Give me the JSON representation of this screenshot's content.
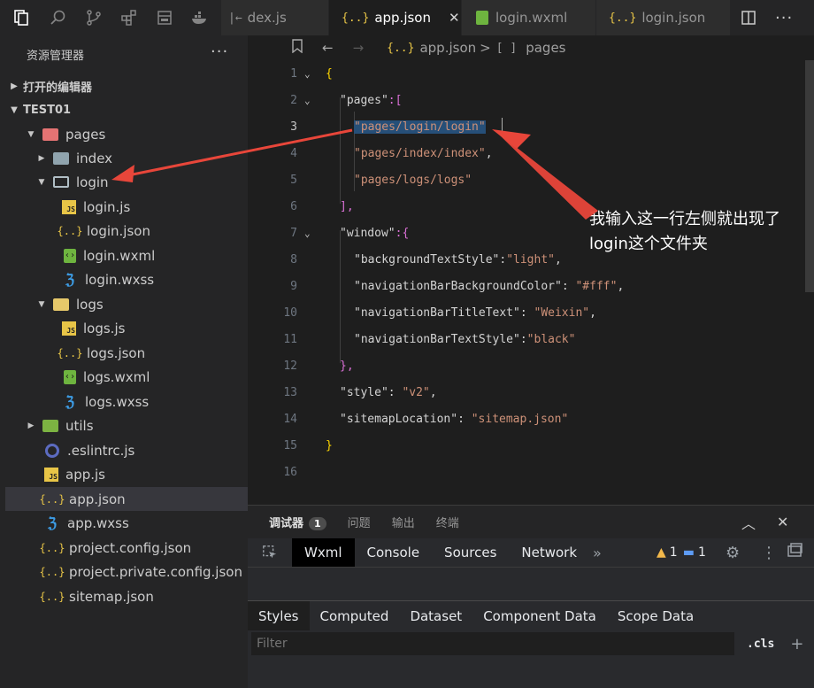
{
  "tabs": [
    {
      "label": "dex.js",
      "icon": "split-icon",
      "active": false
    },
    {
      "label": "app.json",
      "icon": "json-icon",
      "active": true
    },
    {
      "label": "login.wxml",
      "icon": "wxml-icon",
      "active": false
    },
    {
      "label": "login.json",
      "icon": "json-icon",
      "active": false
    }
  ],
  "tab_close": "✕",
  "json_icon_glyph": "{..}",
  "sidebar": {
    "title": "资源管理器",
    "more": "···",
    "open_editors": "打开的编辑器",
    "project": "TEST01",
    "items": [
      {
        "label": "pages",
        "icon": "folder-red"
      },
      {
        "label": "index",
        "icon": "folder"
      },
      {
        "label": "login",
        "icon": "folder-open"
      },
      {
        "label": "login.js",
        "icon": "js"
      },
      {
        "label": "login.json",
        "icon": "json"
      },
      {
        "label": "login.wxml",
        "icon": "wxml"
      },
      {
        "label": "login.wxss",
        "icon": "wxss"
      },
      {
        "label": "logs",
        "icon": "folder-yellow"
      },
      {
        "label": "logs.js",
        "icon": "js"
      },
      {
        "label": "logs.json",
        "icon": "json"
      },
      {
        "label": "logs.wxml",
        "icon": "wxml"
      },
      {
        "label": "logs.wxss",
        "icon": "wxss"
      },
      {
        "label": "utils",
        "icon": "folder-green"
      },
      {
        "label": ".eslintrc.js",
        "icon": "eslint"
      },
      {
        "label": "app.js",
        "icon": "js"
      },
      {
        "label": "app.json",
        "icon": "json",
        "selected": true
      },
      {
        "label": "app.wxss",
        "icon": "wxss"
      },
      {
        "label": "project.config.json",
        "icon": "json"
      },
      {
        "label": "project.private.config.json",
        "icon": "json"
      },
      {
        "label": "sitemap.json",
        "icon": "json"
      }
    ]
  },
  "breadcrumb": {
    "file": "app.json",
    "separator": ">",
    "node_icon": "[ ]",
    "node": "pages"
  },
  "editor": {
    "line_numbers": [
      "1",
      "2",
      "3",
      "4",
      "5",
      "6",
      "7",
      "8",
      "9",
      "10",
      "11",
      "12",
      "13",
      "14",
      "15",
      "16"
    ],
    "current_line": "3",
    "code": {
      "l1": "{",
      "l2_key": "\"pages\"",
      "l2_rest": ":[",
      "l3": "\"pages/login/login\"",
      "l4": "\"pages/index/index\"",
      "l4_comma": ",",
      "l5": "\"pages/logs/logs\"",
      "l6": "],",
      "l7_key": "\"window\"",
      "l7_rest": ":{",
      "l8_key": "\"backgroundTextStyle\"",
      "l8_val": "\"light\"",
      "l9_key": "\"navigationBarBackgroundColor\"",
      "l9_val": "\"#fff\"",
      "l10_key": "\"navigationBarTitleText\"",
      "l10_val": "\"Weixin\"",
      "l11_key": "\"navigationBarTextStyle\"",
      "l11_val": "\"black\"",
      "l12": "},",
      "l13_key": "\"style\"",
      "l13_val": "\"v2\"",
      "l14_key": "\"sitemapLocation\"",
      "l14_val": "\"sitemap.json\"",
      "l15": "}",
      "colon": ":",
      "colon_sp": ": ",
      "comma": ","
    }
  },
  "annotation": "我输入这一行左侧就出现了login这个文件夹",
  "panel": {
    "tabs": [
      "调试器",
      "问题",
      "输出",
      "终端"
    ],
    "badge": "1"
  },
  "devtools": {
    "tabs": [
      "Wxml",
      "Console",
      "Sources",
      "Network"
    ],
    "more": "»",
    "warnings": "1",
    "messages": "1"
  },
  "styles_tabs": [
    "Styles",
    "Computed",
    "Dataset",
    "Component Data",
    "Scope Data"
  ],
  "filter": {
    "placeholder": "Filter",
    "cls": ".cls",
    "plus": "+"
  },
  "colors": {
    "selection": "#264f78",
    "arrow": "#e8463a",
    "json_icon": "#e8c547",
    "wxml_icon": "#6eb43f",
    "wxss_icon": "#3d9de6"
  }
}
